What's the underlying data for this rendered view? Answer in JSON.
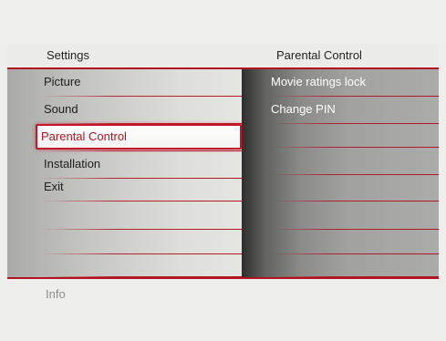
{
  "header": {
    "left_title": "Settings",
    "right_title": "Parental Control"
  },
  "menu": {
    "items": [
      {
        "label": "Picture"
      },
      {
        "label": "Sound"
      },
      {
        "label": "Parental Control",
        "selected": true
      },
      {
        "label": "Installation"
      },
      {
        "label": "Exit"
      },
      {
        "label": ""
      },
      {
        "label": ""
      },
      {
        "label": ""
      }
    ]
  },
  "submenu": {
    "items": [
      {
        "label": "Movie ratings lock"
      },
      {
        "label": "Change PIN"
      },
      {
        "label": ""
      },
      {
        "label": ""
      },
      {
        "label": ""
      },
      {
        "label": ""
      },
      {
        "label": ""
      },
      {
        "label": ""
      }
    ]
  },
  "footer": {
    "info_label": "Info"
  },
  "colors": {
    "accent": "#b01622",
    "selected_text": "#b4141f"
  }
}
